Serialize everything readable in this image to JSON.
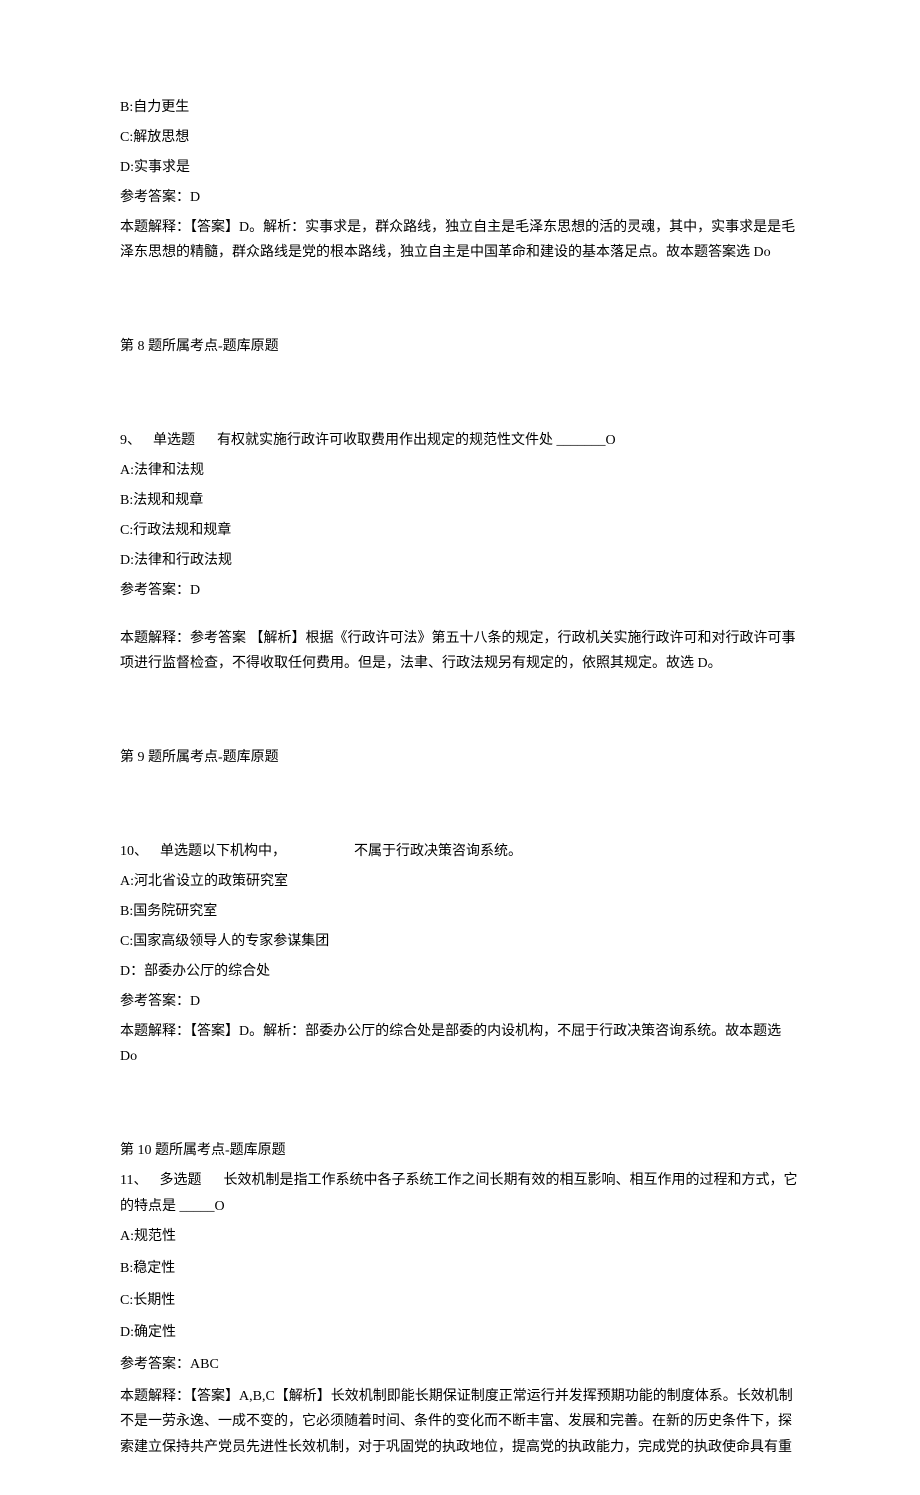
{
  "q8": {
    "optB": "B:自力更生",
    "optC": "C:解放思想",
    "optD": "D:实事求是",
    "answerLabel": "参考答案：D",
    "explain": "本题解释：【答案】D。解析：实事求是，群众路线，独立自主是毛泽东思想的活的灵魂，其中，实事求是是毛泽东思想的精髓，群众路线是党的根本路线，独立自主是中国革命和建设的基本落足点。故本题答案选 Do",
    "tag": "第 8 题所属考点-题库原题"
  },
  "q9": {
    "num": "9、",
    "type": "单选题",
    "stem": "有权就实施行政许可收取费用作出规定的规范性文件处 _______O",
    "optA": "A:法律和法规",
    "optB": "B:法规和规章",
    "optC": "C:行政法规和规章",
    "optD": "D:法律和行政法规",
    "answerLabel": "参考答案：D",
    "explain": "本题解释：参考答案      【解析】根据《行政许可法》第五十八条的规定，行政机关实施行政许可和对行政许可事项进行监督检查，不得收取任何费用。但是，法聿、行政法规另有规定的，依照其规定。故选 D。",
    "tag": "第 9 题所属考点-题库原题"
  },
  "q10": {
    "num": "10、",
    "type": "单选题以下机构中，",
    "stem": "不属于行政决策咨询系统。",
    "optA": "A:河北省设立的政策研究室",
    "optB": "B:国务院研究室",
    "optC": "C:国家高级领导人的专家参谋集团",
    "optD": "D：部委办公厅的综合处",
    "answerLabel": "参考答案：D",
    "explain": "本题解释：【答案】D。解析：部委办公厅的综合处是部委的内设机构，不屈于行政决策咨询系统。故本题选 Do",
    "tag": "第 10 题所属考点-题库原题"
  },
  "q11": {
    "num": "11、",
    "type": "多选题",
    "stem": "长效机制是指工作系统中各子系统工作之间长期有效的相互影响、相互作用的过程和方式，它的特点是 _____O",
    "optA": "A:规范性",
    "optB": "B:稳定性",
    "optC": "C:长期性",
    "optD": "D:确定性",
    "answerLabel": "参考答案：ABC",
    "explain": "本题解释：【答案】A,B,C【解析】长效机制即能长期保证制度正常运行并发挥预期功能的制度体系。长效机制不是一劳永逸、一成不变的，它必须随着时间、条件的变化而不断丰富、发展和完善。在新的历史条件下，探索建立保持共产党员先进性长效机制，对于巩固党的执政地位，提高党的执政能力，完成党的执政使命具有重"
  }
}
